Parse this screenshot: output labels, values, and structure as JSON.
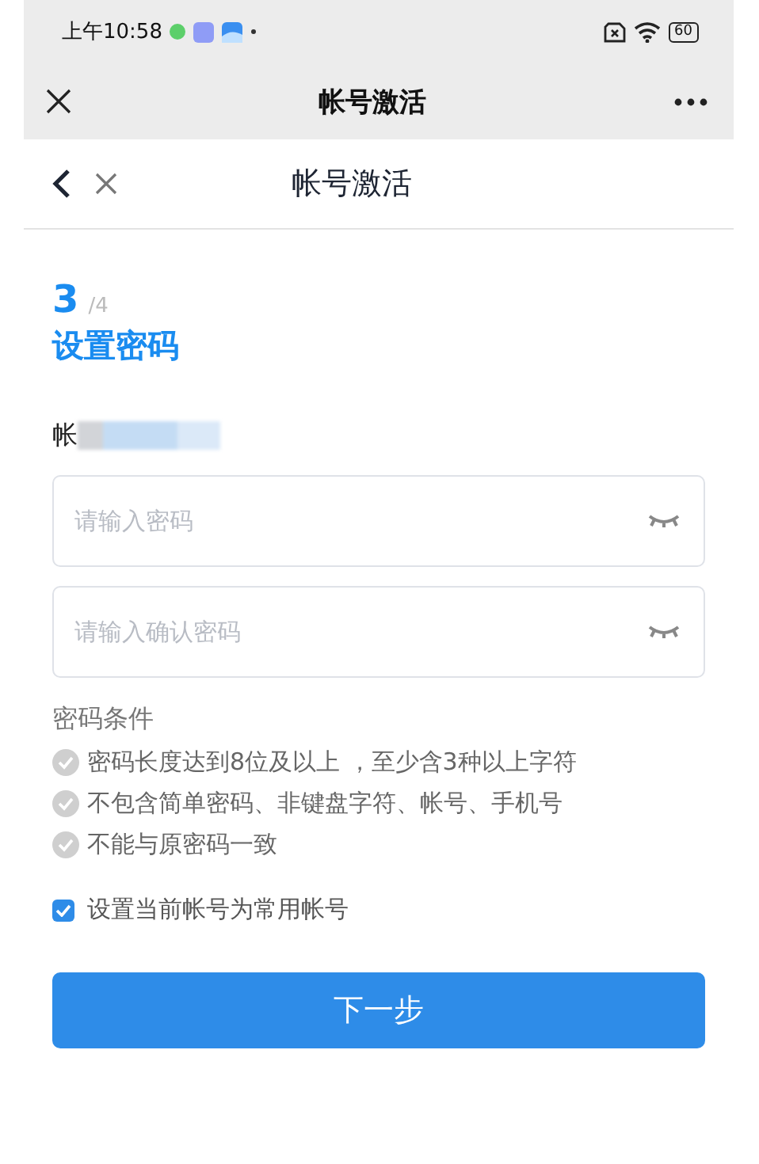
{
  "status_bar": {
    "time": "上午10:58",
    "battery": "60"
  },
  "app_bar": {
    "title": "帐号激活"
  },
  "page_header": {
    "title": "帐号激活"
  },
  "step": {
    "current": "3",
    "total": "/4",
    "title": "设置密码"
  },
  "account": {
    "label": "帐"
  },
  "fields": [
    {
      "placeholder": "请输入密码"
    },
    {
      "placeholder": "请输入确认密码"
    }
  ],
  "rules": {
    "title": "密码条件",
    "items": [
      {
        "text": "密码长度达到8位及以上 ，至少含3种以上字符",
        "met": false
      },
      {
        "text": "不包含简单密码、非键盘字符、帐号、手机号",
        "met": false
      },
      {
        "text": "不能与原密码一致",
        "met": false
      }
    ]
  },
  "default_account": {
    "label": "设置当前帐号为常用帐号",
    "checked": true
  },
  "next_button": {
    "label": "下一步"
  }
}
